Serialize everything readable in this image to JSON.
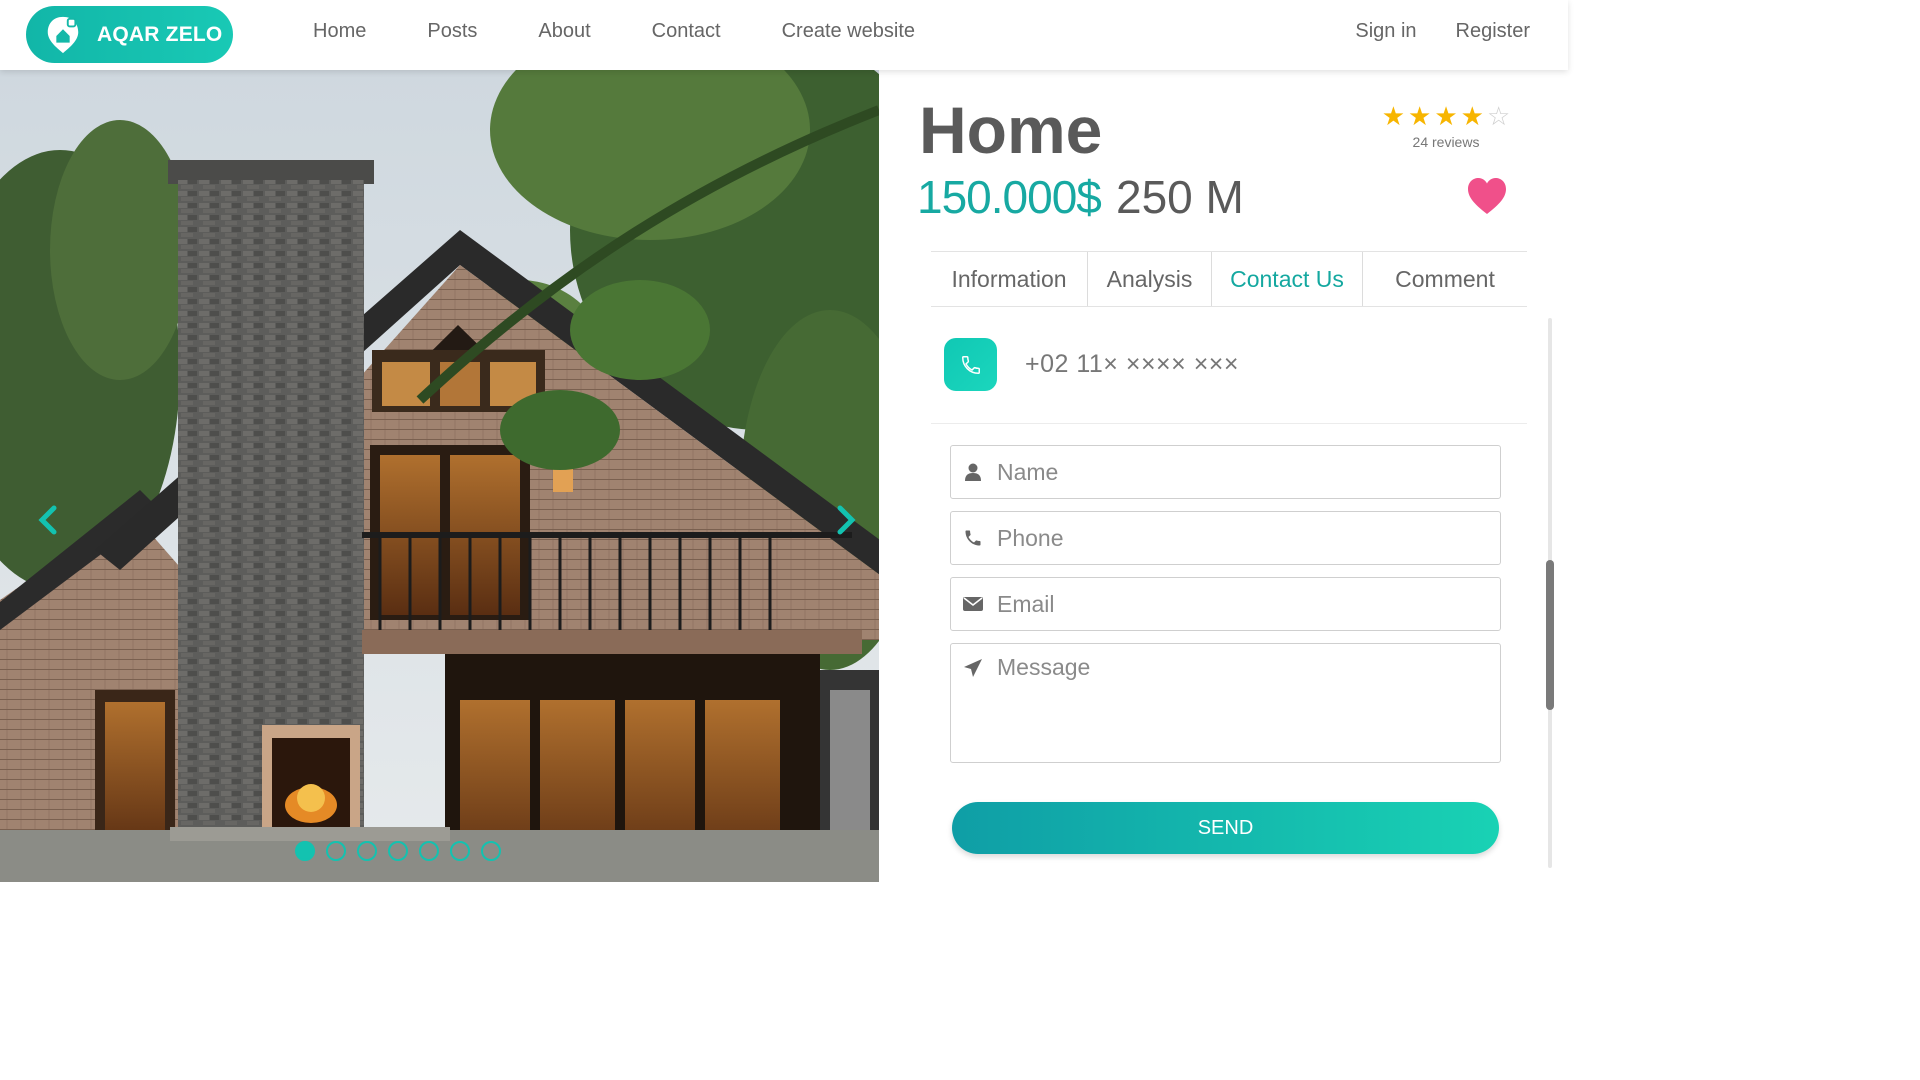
{
  "brand": {
    "name": "AQAR ZELO",
    "accent": "#13c2b0",
    "accent_dark": "#14a8a0",
    "favorite_color": "#f0508a",
    "star_color": "#f7b500"
  },
  "nav": {
    "items": [
      "Home",
      "Posts",
      "About",
      "Contact",
      "Create website"
    ],
    "sign_in": "Sign in",
    "register": "Register"
  },
  "listing": {
    "title": "Home",
    "price": "150.000$",
    "area": "250 M",
    "rating": {
      "stars": 4,
      "max": 5,
      "reviews_label": "24 reviews"
    }
  },
  "carousel": {
    "slides": 7,
    "active": 1,
    "prev_icon": "chevron-left-icon",
    "next_icon": "chevron-right-icon"
  },
  "tabs": [
    {
      "label": "Information",
      "active": false
    },
    {
      "label": "Analysis",
      "active": false
    },
    {
      "label": "Contact Us",
      "active": true
    },
    {
      "label": "Comment",
      "active": false
    }
  ],
  "contact": {
    "phone": "+02 11× ×××× ×××",
    "form": {
      "name_placeholder": "Name",
      "phone_placeholder": "Phone",
      "email_placeholder": "Email",
      "message_placeholder": "Message",
      "send_label": "SEND"
    }
  }
}
